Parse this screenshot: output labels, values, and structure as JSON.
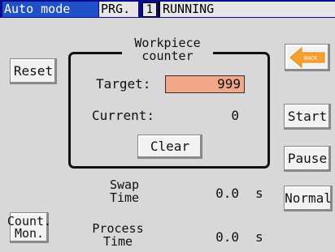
{
  "header": {
    "mode": "Auto mode",
    "program_label": "PRG.",
    "program_number": "1",
    "status": "RUNNING"
  },
  "counter": {
    "title_line1": "Workpiece",
    "title_line2": "counter",
    "target_label": "Target:",
    "target_value": "999",
    "current_label": "Current:",
    "current_value": "0",
    "clear_label": "Clear"
  },
  "buttons": {
    "reset": "Reset",
    "back": "BACK",
    "start": "Start",
    "pause": "Pause",
    "normal": "Normal",
    "count_mon_line1": "Count.",
    "count_mon_line2": "Mon."
  },
  "times": {
    "swap_line1": "Swap",
    "swap_line2": "Time",
    "swap_value": "0.0",
    "swap_unit": "s",
    "process_line1": "Process",
    "process_line2": "Time",
    "process_value": "0.0",
    "process_unit": "s"
  },
  "colors": {
    "header_bg": "#0a0a8c",
    "mode_bg": "#2050c8",
    "target_field_bg": "#f2a68a",
    "back_arrow": "#f5a030"
  },
  "icons": {
    "back": "left-arrow-icon"
  }
}
